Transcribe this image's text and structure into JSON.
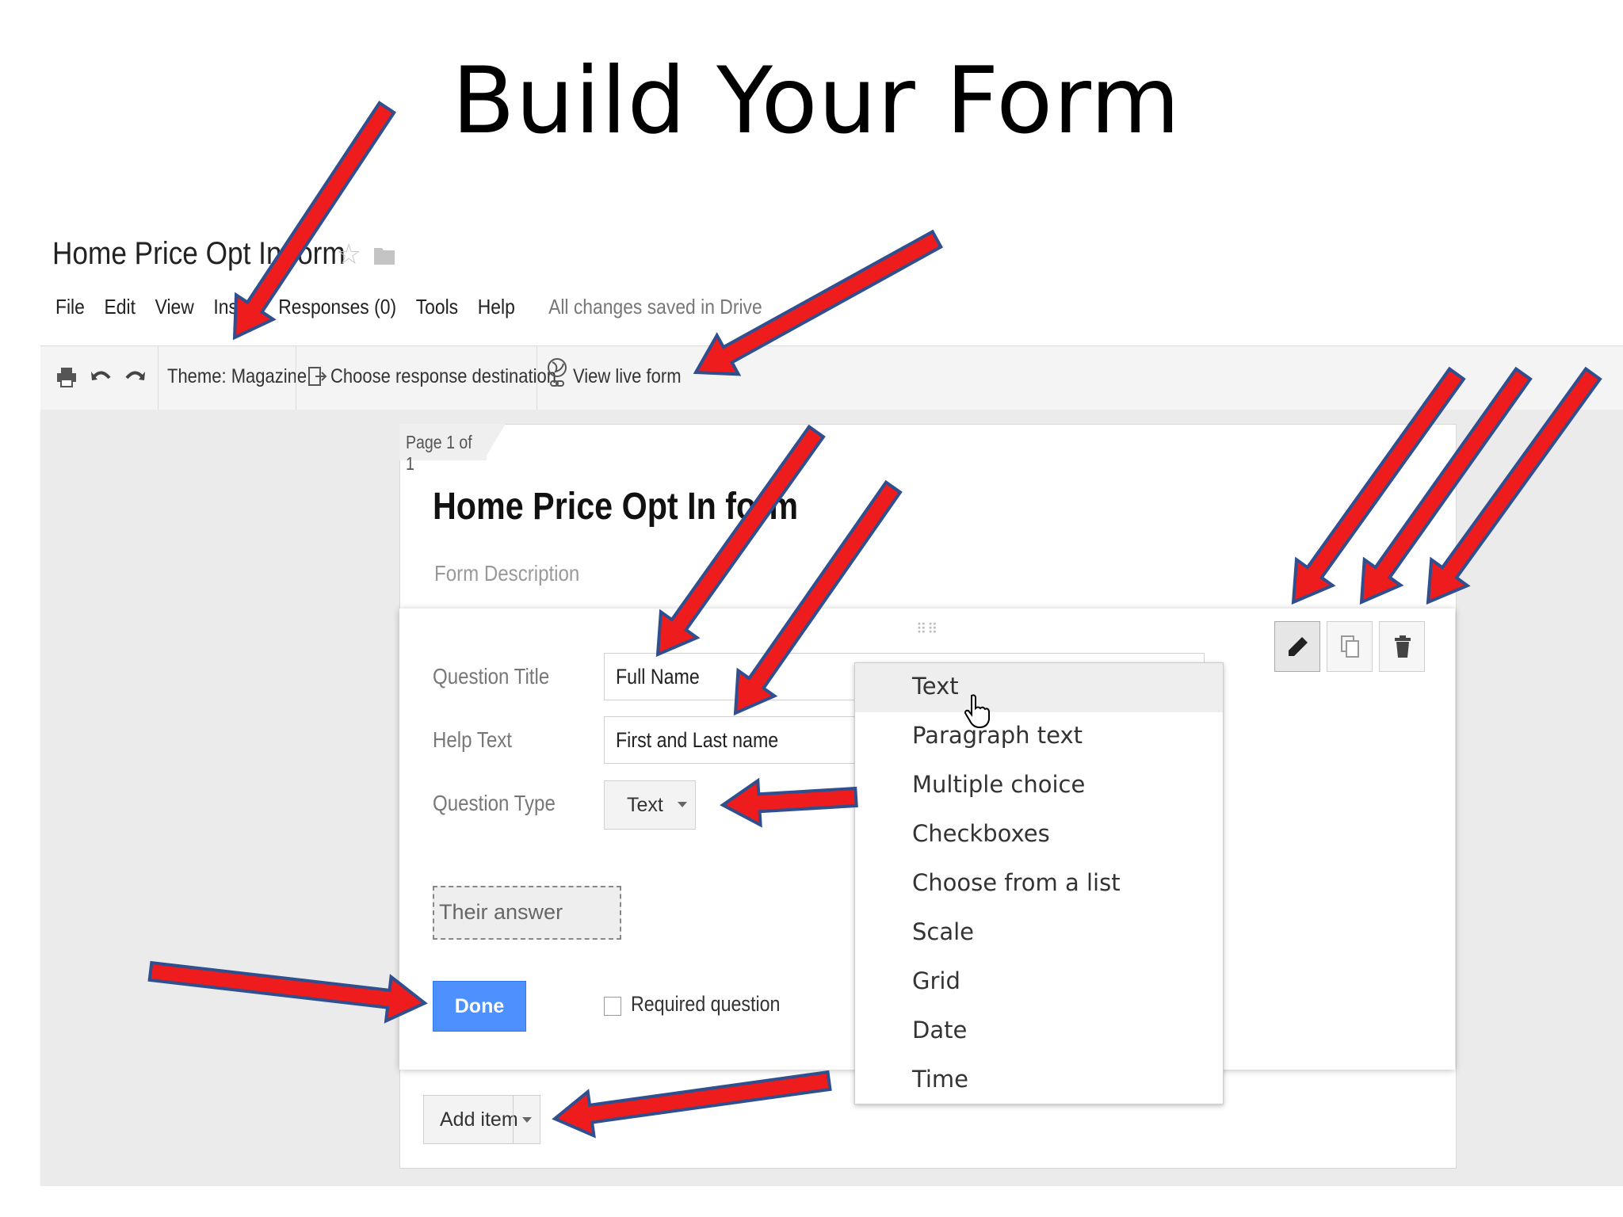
{
  "slide": {
    "title": "Build Your Form"
  },
  "app": {
    "doc_title": "Home Price Opt In form",
    "menu": [
      "File",
      "Edit",
      "View",
      "Insert",
      "Responses (0)",
      "Tools",
      "Help"
    ],
    "save_status": "All changes saved in Drive"
  },
  "toolbar": {
    "theme_label": "Theme: Magazine",
    "destination_label": "Choose response destination",
    "live_form_label": "View live form"
  },
  "form": {
    "page_label": "Page 1 of 1",
    "title": "Home Price Opt In form",
    "description_placeholder": "Form Description"
  },
  "question": {
    "title_label": "Question Title",
    "title_value": "Full Name",
    "help_label": "Help Text",
    "help_value": "First and Last name",
    "type_label": "Question Type",
    "type_value": "Text",
    "answer_preview": "Their answer",
    "done_label": "Done",
    "required_label": "Required question",
    "required_checked": false
  },
  "type_dropdown": {
    "items": [
      "Text",
      "Paragraph text",
      "Multiple choice",
      "Checkboxes",
      "Choose from a list",
      "Scale",
      "Grid",
      "Date",
      "Time"
    ],
    "highlighted": "Text"
  },
  "add_item": {
    "label": "Add item"
  },
  "colors": {
    "arrow_fill": "#ee1c1c",
    "arrow_outline": "#2f4f8f",
    "done_blue": "#4d90fe"
  }
}
